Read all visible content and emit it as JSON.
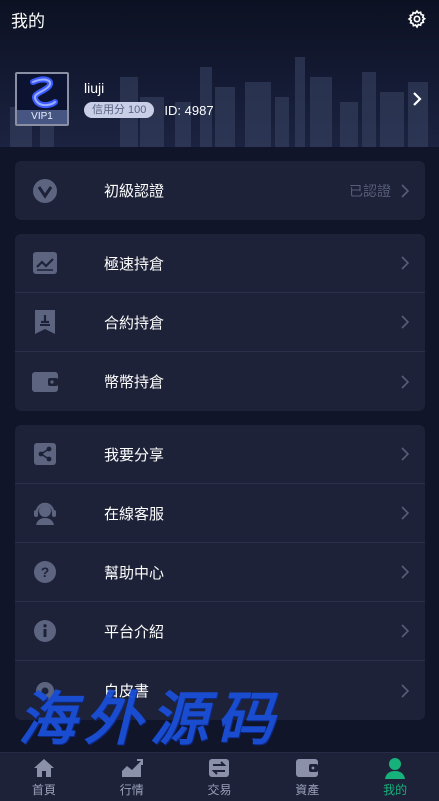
{
  "header": {
    "title": "我的"
  },
  "profile": {
    "avatar_badge": "VIP1",
    "username": "liuji",
    "credit": "信用分 100",
    "uid": "ID: 4987"
  },
  "cards": [
    {
      "items": [
        {
          "label": "初級認證",
          "value": "已認證",
          "icon": "v-badge-icon"
        }
      ]
    },
    {
      "items": [
        {
          "label": "極速持倉",
          "icon": "trend-chart-icon"
        },
        {
          "label": "合約持倉",
          "icon": "contract-icon"
        },
        {
          "label": "幣幣持倉",
          "icon": "wallet-icon"
        }
      ]
    },
    {
      "items": [
        {
          "label": "我要分享",
          "icon": "share-icon"
        },
        {
          "label": "在線客服",
          "icon": "support-icon"
        },
        {
          "label": "幫助中心",
          "icon": "help-icon"
        },
        {
          "label": "平台介紹",
          "icon": "info-icon"
        },
        {
          "label": "白皮書",
          "icon": "settings-icon"
        }
      ]
    }
  ],
  "watermark": "海外源码",
  "nav": [
    {
      "label": "首頁",
      "icon": "home-icon"
    },
    {
      "label": "行情",
      "icon": "market-icon"
    },
    {
      "label": "交易",
      "icon": "exchange-icon"
    },
    {
      "label": "資產",
      "icon": "assets-wallet-icon"
    },
    {
      "label": "我的",
      "icon": "user-icon",
      "active": true
    }
  ],
  "colors": {
    "background": "#10152a",
    "card": "#1d2238",
    "accent": "#17b27c",
    "icon": "#5c6480"
  }
}
